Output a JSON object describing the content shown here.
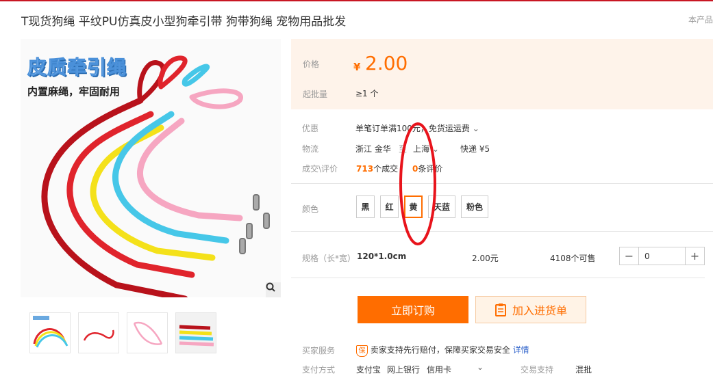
{
  "title": "T现货狗绳 平纹PU仿真皮小型狗牵引带 狗带狗绳 宠物用品批发",
  "corner_text": "本产品",
  "image": {
    "banner": "皮质牵引绳",
    "subbanner": "内置麻绳，牢固耐用"
  },
  "price": {
    "label": "价格",
    "currency": "¥",
    "value": "2.00",
    "min_label": "起批量",
    "min_value": "≥1 个"
  },
  "promo": {
    "label": "优惠",
    "text": "单笔订单满100元，免货运运费"
  },
  "logistics": {
    "label": "物流",
    "from": "浙江 金华",
    "to_word": "至",
    "to": "上海",
    "express": "快递 ¥5"
  },
  "deals": {
    "label": "成交\\评价",
    "count": "713",
    "count_suffix": "个成交",
    "reviews": "0",
    "reviews_suffix": "条评价"
  },
  "colors": {
    "label": "颜色",
    "options": [
      "黑",
      "红",
      "黄",
      "天蓝",
      "粉色"
    ],
    "selected": "黄"
  },
  "spec": {
    "label": "规格（长*宽）",
    "value": "120*1.0cm",
    "price": "2.00元",
    "stock": "4108个可售",
    "quantity": "0"
  },
  "buttons": {
    "buy": "立即订购",
    "cart": "加入进货单"
  },
  "services": {
    "label": "买家服务",
    "badge": "保",
    "text": "卖家支持先行赔付，保障买家交易安全",
    "link": "详情"
  },
  "payment": {
    "label": "支付方式",
    "methods": [
      "支付宝",
      "网上银行",
      "信用卡"
    ],
    "trade_label": "交易支持",
    "trade_value": "混批"
  },
  "colors_palette": {
    "accent": "#ff6d00",
    "annotation": "#e8141c"
  }
}
